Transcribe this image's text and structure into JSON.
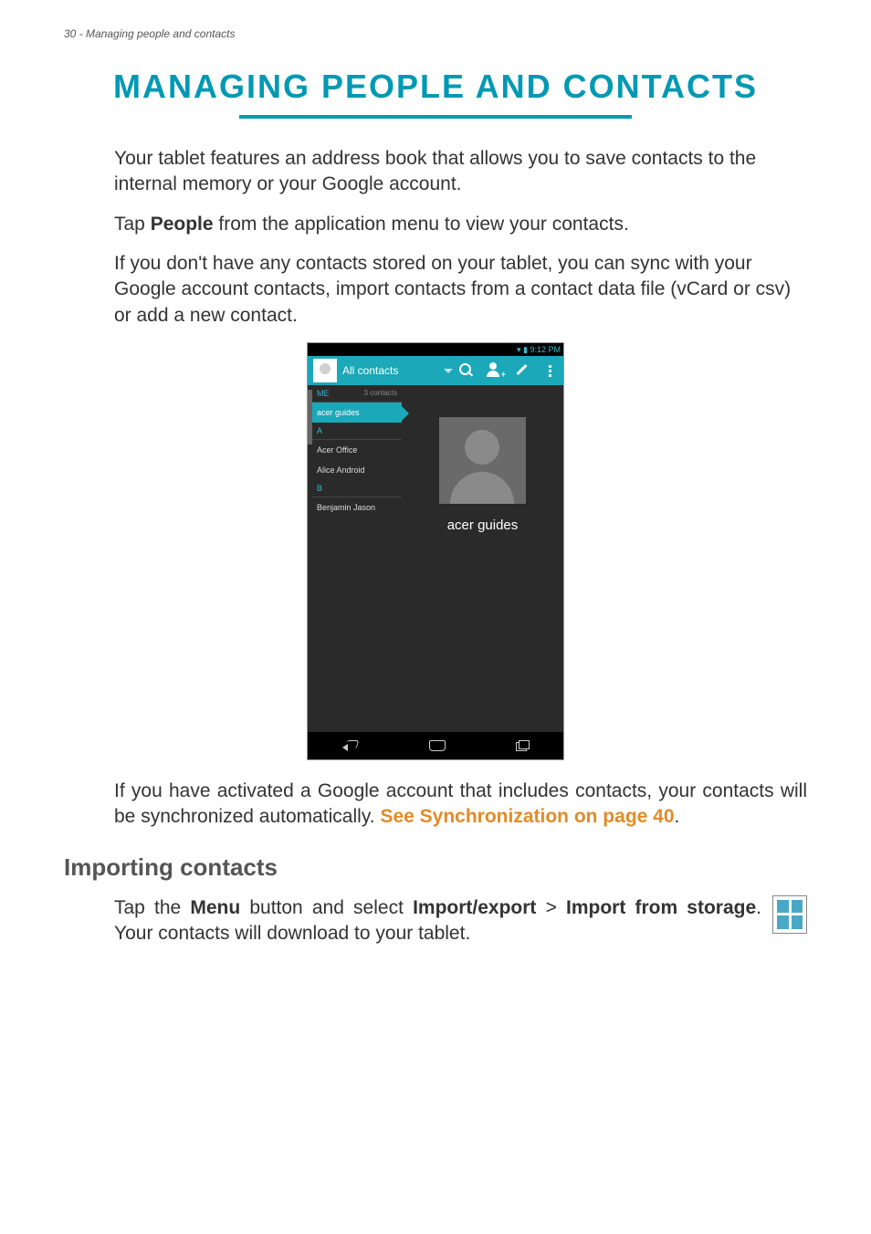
{
  "header": {
    "page_num": "30",
    "section": "Managing people and contacts",
    "header_text": "30 - Managing people and contacts"
  },
  "title": "MANAGING PEOPLE AND CONTACTS",
  "para1": "Your tablet features an address book that allows you to save contacts to the internal memory or your Google account.",
  "para2_a": "Tap ",
  "para2_b": "People",
  "para2_c": " from the application menu to view your contacts.",
  "para3": "If you don't have any contacts stored on your tablet, you can sync with your Google account contacts, import contacts from a contact data file (vCard or csv) or add a new contact.",
  "screenshot": {
    "status_time": "9:12 PM",
    "appbar_title": "All contacts",
    "me_label": "ME",
    "contact_count": "3 contacts",
    "selected": "acer guides",
    "letter_a": "A",
    "c_a1": "Acer Office",
    "c_a2": "Alice Android",
    "letter_b": "B",
    "c_b1": "Benjamin Jason",
    "detail_name": "acer guides"
  },
  "para4_a": "If you have activated a Google account that includes contacts, your contacts will be synchronized automatically. ",
  "para4_link": "See Synchronization on page 40",
  "para4_b": ".",
  "h2": "Importing contacts",
  "import_a": "Tap the ",
  "import_b": "Menu",
  "import_c": " button and select ",
  "import_d": "Import/export",
  "import_e": " > ",
  "import_f": "Import from storage",
  "import_g": ". Your contacts will download to your tablet."
}
